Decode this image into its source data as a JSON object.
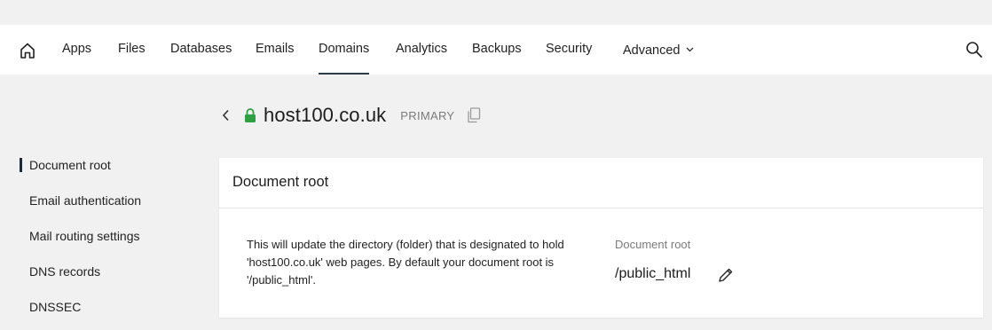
{
  "nav": {
    "home_icon": "home-icon",
    "items": [
      {
        "label": "Apps"
      },
      {
        "label": "Files"
      },
      {
        "label": "Databases"
      },
      {
        "label": "Emails"
      },
      {
        "label": "Domains",
        "active": true
      },
      {
        "label": "Analytics"
      },
      {
        "label": "Backups"
      },
      {
        "label": "Security"
      },
      {
        "label": "Advanced",
        "has_dropdown": true
      }
    ],
    "search_icon": "search-icon"
  },
  "header": {
    "domain": "host100.co.uk",
    "badge": "PRIMARY",
    "lock_color": "#2ea043"
  },
  "sidebar": {
    "items": [
      {
        "label": "Document root",
        "active": true
      },
      {
        "label": "Email authentication"
      },
      {
        "label": "Mail routing settings"
      },
      {
        "label": "DNS records"
      },
      {
        "label": "DNSSEC"
      }
    ]
  },
  "card": {
    "title": "Document root",
    "description": "This will update the directory (folder) that is designated to hold 'host100.co.uk' web pages. By default your document root is '/public_html'.",
    "field_label": "Document root",
    "field_value": "/public_html"
  }
}
